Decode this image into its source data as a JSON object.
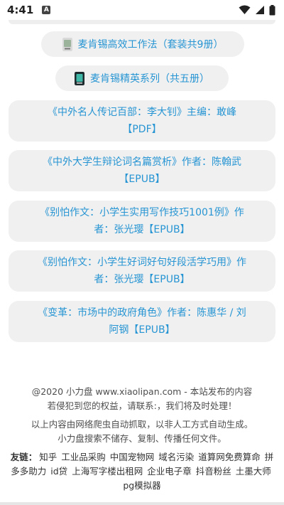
{
  "status": {
    "time": "4:41",
    "notification_badge": "A",
    "icons": [
      "wifi-icon",
      "signal-icon",
      "battery-icon"
    ]
  },
  "pills": [
    {
      "label": "麦肯锡高效工作法（套装共9册）",
      "icon": "book-cover-icon"
    },
    {
      "label": "麦肯锡精英系列（共五册）",
      "icon": "book-cover-icon"
    }
  ],
  "cards": [
    {
      "line1": "《中外名人传记百部：李大钊》主编：敢峰",
      "line2": "【PDF】"
    },
    {
      "line1": "《中外大学生辩论词名篇赏析》作者：陈翰武",
      "line2": "【EPUB】"
    },
    {
      "line1": "《别怕作文：小学生实用写作技巧1001例》作",
      "line2": "者：张光璎【EPUB】"
    },
    {
      "line1": "《别怕作文：小学生好词好句好段活学巧用》作",
      "line2": "者：张光璎【EPUB】"
    },
    {
      "line1": "《变革：市场中的政府角色》作者：陈惠华 / 刘",
      "line2": "阿钢【EPUB】"
    }
  ],
  "footer": {
    "copyright_line1": "@2020 小力盘 www.xiaolipan.com - 本站发布的内容",
    "copyright_line2": "若侵犯到您的权益，请联系:，我们将及时处理！",
    "notice_line1": "以上内容由网络爬虫自动抓取，以非人工方式自动生成。",
    "notice_line2": "小力盘搜索不储存、复制、传播任何文件。",
    "links_label": "友链：",
    "links": [
      "知乎",
      "工业品采购",
      "中国宠物网",
      "域名污染",
      "道算网免费算命",
      "拼多多助力",
      "id贷",
      "上海写字楼出租网",
      "企业电子章",
      "抖音粉丝",
      "土墨大师",
      "pg模拟器"
    ]
  },
  "colors": {
    "link_blue": "#2795d3",
    "card_bg": "#f0f0f0"
  }
}
